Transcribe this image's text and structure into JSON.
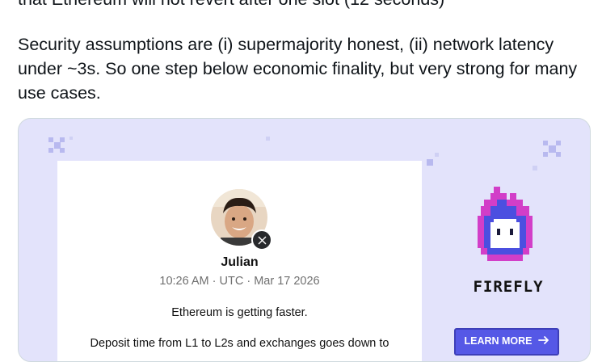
{
  "post": {
    "line0": "that Ethereum will not revert after one slot (12 seconds)",
    "line1": "Security assumptions are (i) supermajority honest, (ii) network latency",
    "line2": "under ~3s. So one step below economic finality, but very strong for many",
    "line3": "use cases."
  },
  "card": {
    "author_name": "Julian",
    "meta": "10:26 AM · UTC · Mar 17 2026",
    "tweet_line1": "Ethereum is getting faster.",
    "tweet_line2": "Deposit time from L1 to L2s and exchanges goes down to",
    "brand": "FIREFLY",
    "cta_label": "LEARN MORE",
    "cta_icon": "arrow-right-icon",
    "badge_icon": "x-logo-icon",
    "colors": {
      "background": "#e3e3fb",
      "button": "#5558e6",
      "flame_primary": "#d23ec8",
      "flame_inner": "#4b4fe0"
    }
  }
}
